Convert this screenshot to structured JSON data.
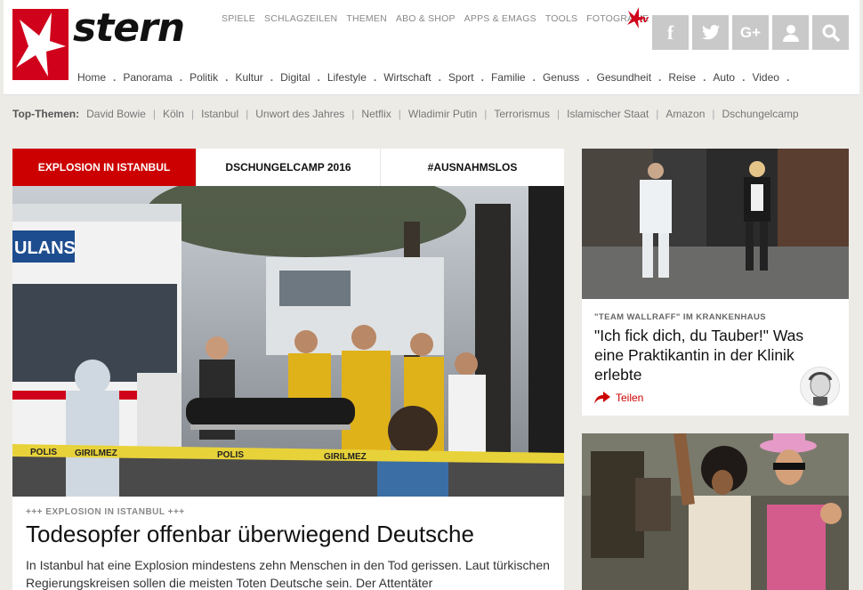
{
  "brand": {
    "logo_text": "stern",
    "sterntv": "tv"
  },
  "top_nav": [
    "SPIELE",
    "SCHLAGZEILEN",
    "THEMEN",
    "ABO & SHOP",
    "APPS & EMAGS",
    "TOOLS",
    "FOTOGRAFIE"
  ],
  "social": [
    {
      "name": "facebook-icon",
      "glyph": "f"
    },
    {
      "name": "twitter-icon",
      "glyph": "t"
    },
    {
      "name": "googleplus-icon",
      "glyph": "G+"
    },
    {
      "name": "user-icon",
      "glyph": ""
    },
    {
      "name": "search-icon",
      "glyph": ""
    }
  ],
  "main_nav": [
    "Home",
    "Panorama",
    "Politik",
    "Kultur",
    "Digital",
    "Lifestyle",
    "Wirtschaft",
    "Sport",
    "Familie",
    "Genuss",
    "Gesundheit",
    "Reise",
    "Auto",
    "Video"
  ],
  "top_themen": {
    "label": "Top-Themen:",
    "items": [
      "David Bowie",
      "Köln",
      "Istanbul",
      "Unwort des Jahres",
      "Netflix",
      "Wladimir Putin",
      "Terrorismus",
      "Islamischer Staat",
      "Amazon",
      "Dschungelcamp"
    ]
  },
  "main_story": {
    "tabs": [
      "EXPLOSION IN ISTANBUL",
      "DSCHUNGELCAMP 2016",
      "#AUSNAHMSLOS"
    ],
    "active_tab": 0,
    "hero_texts": {
      "ambulance": "ULANS",
      "tape1": "POLIS",
      "tape2": "GIRILMEZ"
    },
    "kicker": "+++ EXPLOSION IN ISTANBUL +++",
    "headline": "Todesopfer offenbar überwiegend Deutsche",
    "teaser": "In Istanbul hat eine Explosion mindestens zehn Menschen in den Tod gerissen. Laut türkischen Regierungskreisen sollen die meisten Toten Deutsche sein. Der Attentäter"
  },
  "side_story": {
    "kicker": "\"TEAM WALLRAFF\" IM KRANKENHAUS",
    "title": "\"Ich fick dich, du Tauber!\" Was eine Praktikantin in der Klinik erlebte",
    "share_label": "Teilen"
  },
  "colors": {
    "brand_red": "#d0021b",
    "tab_red": "#cc0000",
    "background": "#ecebe6"
  }
}
